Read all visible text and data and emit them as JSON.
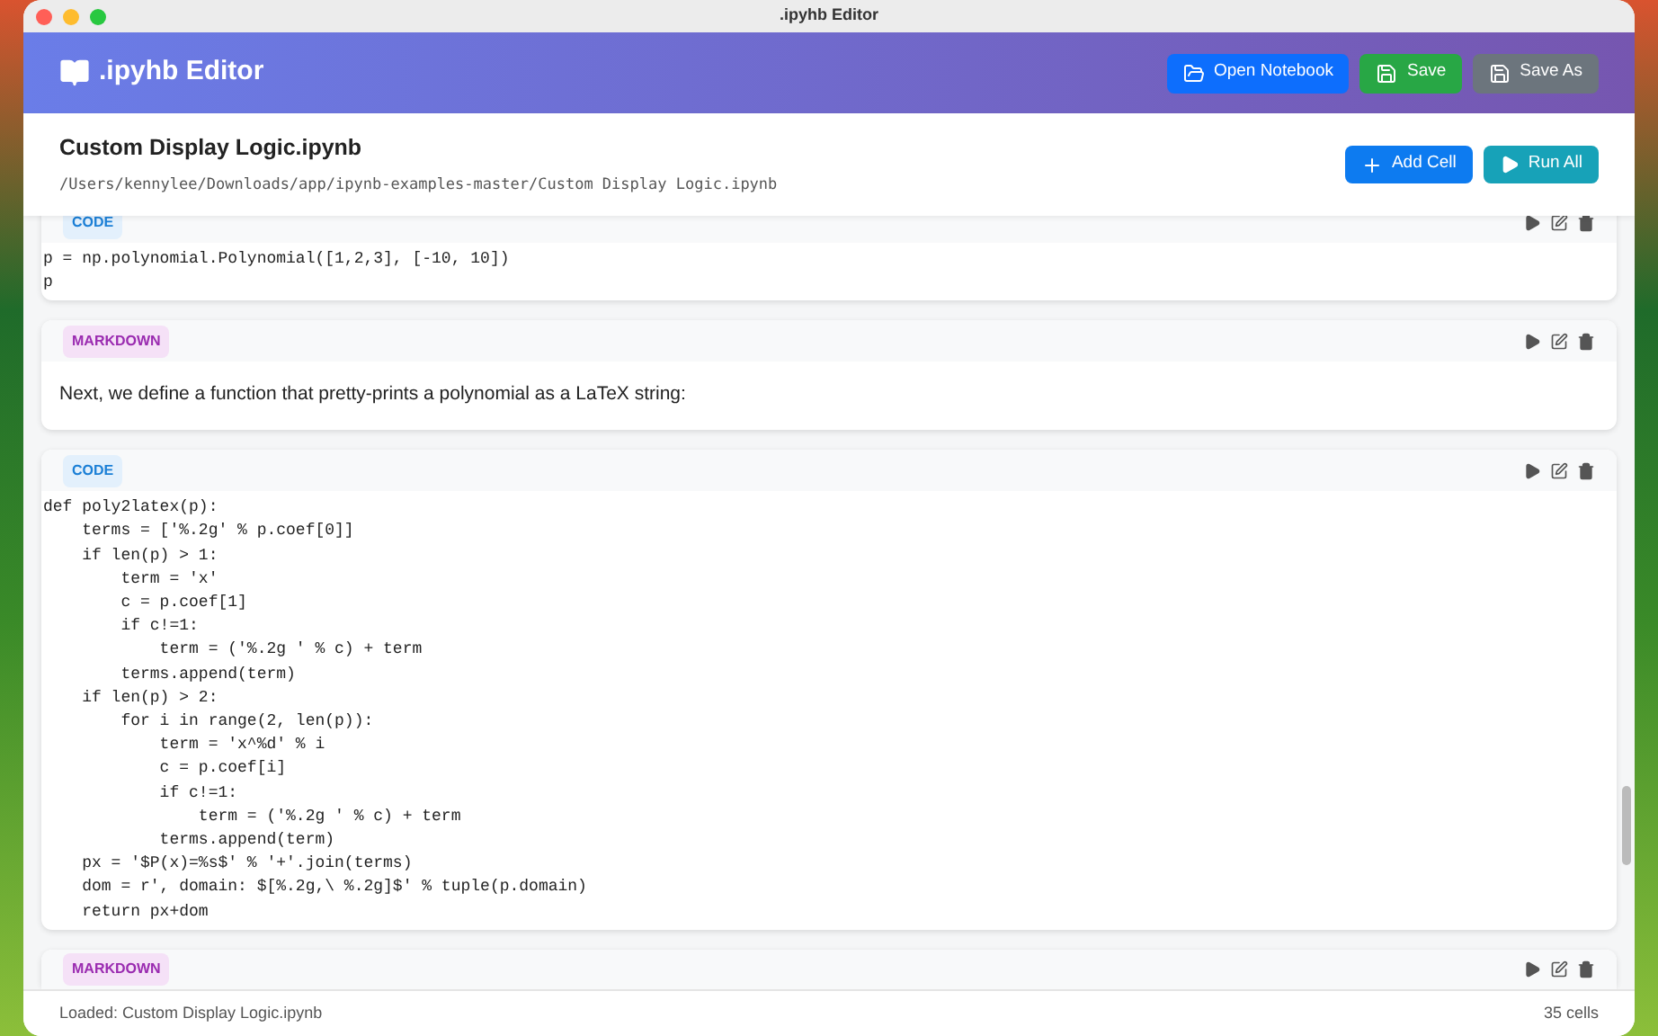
{
  "window": {
    "title": ".ipyhb Editor"
  },
  "header": {
    "title": ".ipyhb Editor",
    "buttons": [
      {
        "label": "Open Notebook",
        "kind": "open"
      },
      {
        "label": "Save",
        "kind": "save"
      },
      {
        "label": "Save As",
        "kind": "saveas"
      }
    ]
  },
  "notebook": {
    "name": "Custom Display Logic.ipynb",
    "path": "/Users/kennylee/Downloads/app/ipynb-examples-master/Custom Display Logic.ipynb",
    "buttons": [
      {
        "label": "Add Cell",
        "kind": "add"
      },
      {
        "label": "Run All",
        "kind": "run"
      }
    ]
  },
  "cells": [
    {
      "kind": "code",
      "badge": "CODE",
      "lines": [
        "p = np.polynomial.Polynomial([1,2,3], [-10, 10])",
        "p"
      ]
    },
    {
      "kind": "markdown",
      "badge": "MARKDOWN",
      "text": "Next, we define a function that pretty-prints a polynomial as a LaTeX string:"
    },
    {
      "kind": "code",
      "badge": "CODE",
      "lines": [
        "def poly2latex(p):",
        "    terms = ['%.2g' % p.coef[0]]",
        "    if len(p) > 1:",
        "        term = 'x'",
        "        c = p.coef[1]",
        "        if c!=1:",
        "            term = ('%.2g ' % c) + term",
        "        terms.append(term)",
        "    if len(p) > 2:",
        "        for i in range(2, len(p)):",
        "            term = 'x^%d' % i",
        "            c = p.coef[i]",
        "            if c!=1:",
        "                term = ('%.2g ' % c) + term",
        "            terms.append(term)",
        "    px = '$P(x)=%s$' % '+'.join(terms)",
        "    dom = r', domain: $[%.2g,\\ %.2g]$' % tuple(p.domain)",
        "    return px+dom"
      ]
    },
    {
      "kind": "markdown",
      "badge": "MARKDOWN"
    }
  ],
  "status_bar": {
    "message": "Loaded: Custom Display Logic.ipynb",
    "count": "35 cells"
  }
}
